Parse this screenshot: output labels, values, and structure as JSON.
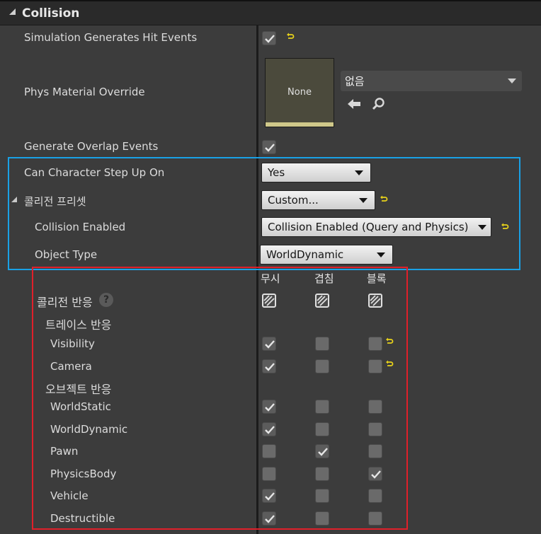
{
  "section": {
    "title": "Collision"
  },
  "rows": {
    "sim_hit": {
      "label": "Simulation Generates Hit Events",
      "checked": true
    },
    "phys_material": {
      "label": "Phys Material Override",
      "thumb_text": "None",
      "combo_value": "없음"
    },
    "overlap": {
      "label": "Generate Overlap Events",
      "checked": true
    },
    "step_up": {
      "label": "Can Character Step Up On",
      "value": "Yes"
    },
    "preset": {
      "label": "콜리전 프리셋",
      "value": "Custom..."
    },
    "enabled": {
      "label": "Collision Enabled",
      "value": "Collision Enabled (Query and Physics)"
    },
    "object_type": {
      "label": "Object Type",
      "value": "WorldDynamic"
    }
  },
  "responses": {
    "columns": [
      "무시",
      "겹침",
      "블록"
    ],
    "header_label": "콜리전 반응",
    "trace_label": "트레이스 반응",
    "object_label": "오브젝트 반응",
    "trace_rows": [
      {
        "name": "Visibility",
        "state": [
          true,
          false,
          false
        ]
      },
      {
        "name": "Camera",
        "state": [
          true,
          false,
          false
        ]
      }
    ],
    "object_rows": [
      {
        "name": "WorldStatic",
        "state": [
          true,
          false,
          false
        ]
      },
      {
        "name": "WorldDynamic",
        "state": [
          true,
          false,
          false
        ]
      },
      {
        "name": "Pawn",
        "state": [
          false,
          true,
          false
        ]
      },
      {
        "name": "PhysicsBody",
        "state": [
          false,
          false,
          true
        ]
      },
      {
        "name": "Vehicle",
        "state": [
          true,
          false,
          false
        ]
      },
      {
        "name": "Destructible",
        "state": [
          true,
          false,
          false
        ]
      }
    ]
  },
  "colors": {
    "highlight_blue": "#19a1e6",
    "highlight_red": "#e0202a",
    "reset_arrow": "#e8d21a"
  }
}
